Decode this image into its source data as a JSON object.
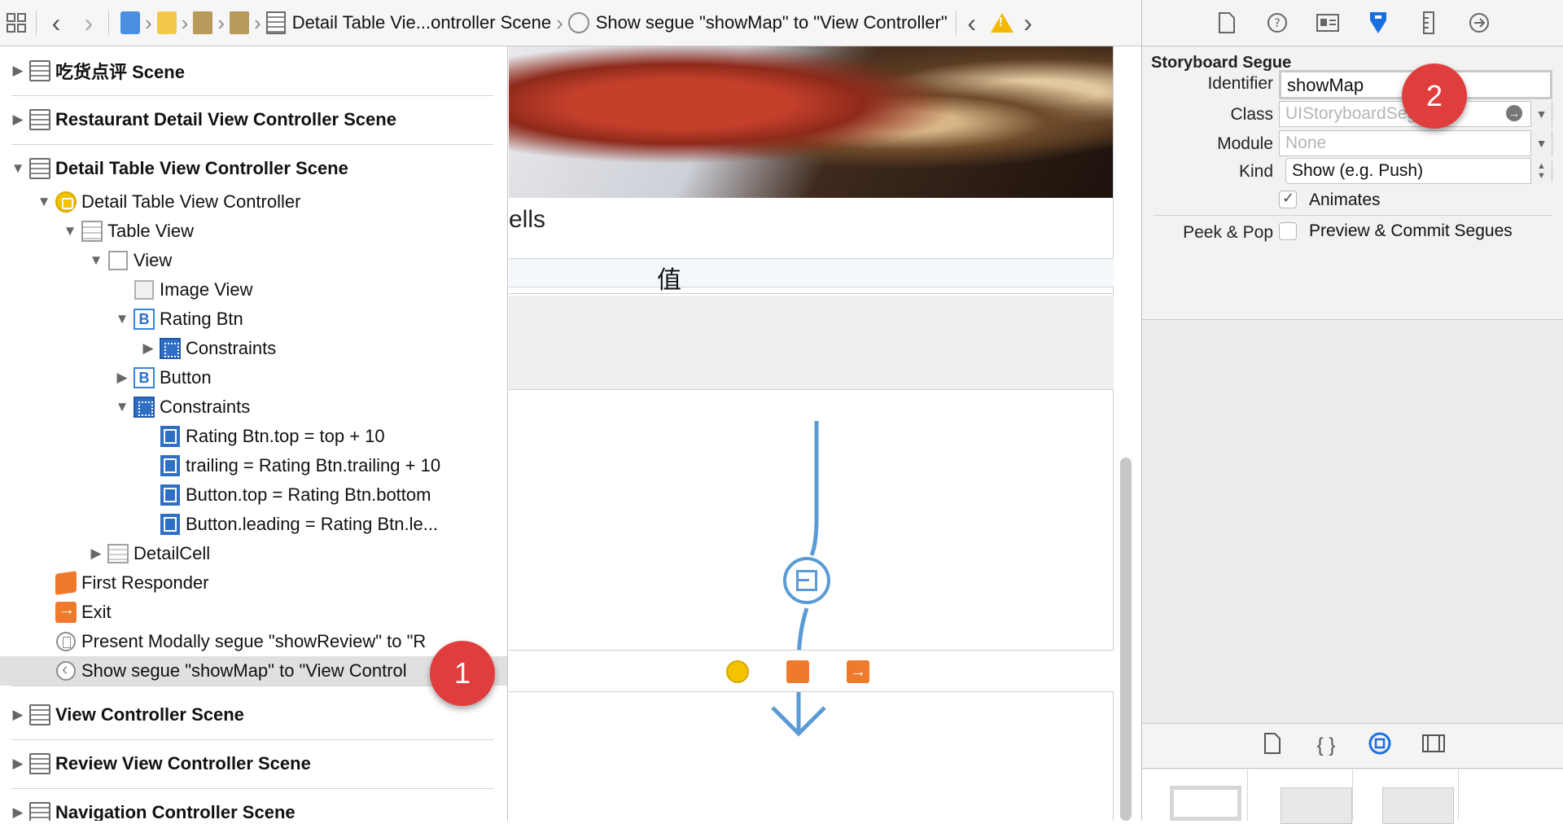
{
  "jump_bar": {
    "scene_label": "Detail Table Vie...ontroller Scene",
    "segue_label": "Show segue \"showMap\" to \"View Controller\""
  },
  "outline": {
    "scenes": [
      {
        "label": "吃货点评 Scene"
      },
      {
        "label": "Restaurant Detail View Controller Scene"
      },
      {
        "label": "Detail Table View Controller Scene"
      },
      {
        "label": "View Controller Scene"
      },
      {
        "label": "Review View Controller Scene"
      },
      {
        "label": "Navigation Controller Scene"
      }
    ],
    "items": {
      "detail_table_vc": "Detail Table View Controller",
      "table_view": "Table View",
      "view": "View",
      "image_view": "Image View",
      "rating_btn": "Rating Btn",
      "rating_constraints": "Constraints",
      "button": "Button",
      "constraints": "Constraints",
      "c1": "Rating Btn.top = top + 10",
      "c2": "trailing = Rating Btn.trailing + 10",
      "c3": "Button.top = Rating Btn.bottom",
      "c4": "Button.leading = Rating Btn.le...",
      "detail_cell": "DetailCell",
      "first_responder": "First Responder",
      "exit": "Exit",
      "segue_modal": "Present Modally segue \"showReview\" to \"R",
      "segue_show": "Show segue \"showMap\" to \"View Control"
    }
  },
  "canvas": {
    "cells_text": "ells",
    "cell_char": "值"
  },
  "inspector": {
    "section_title": "Storyboard Segue",
    "identifier_label": "Identifier",
    "identifier_value": "showMap",
    "class_label": "Class",
    "class_placeholder": "UIStoryboardSegue",
    "module_label": "Module",
    "module_placeholder": "None",
    "kind_label": "Kind",
    "kind_value": "Show (e.g. Push)",
    "animates_label": "Animates",
    "animates_checked": true,
    "peek_label": "Peek & Pop",
    "peek_option": "Preview & Commit Segues",
    "peek_checked": false
  },
  "callouts": {
    "one": "1",
    "two": "2"
  },
  "colors": {
    "accent": "#1a6fe0",
    "segue_line": "#5b9bd5",
    "callout": "#e03e3e"
  }
}
